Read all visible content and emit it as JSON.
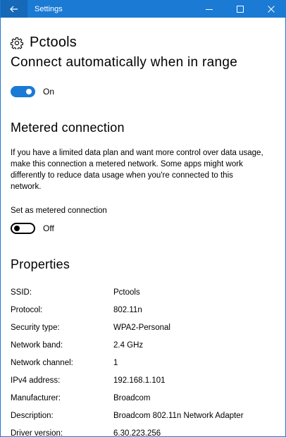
{
  "window": {
    "title": "Settings",
    "accent_color": "#1a7ad4"
  },
  "network": {
    "name": "Pctools",
    "icon": "gear-icon"
  },
  "connect_auto": {
    "heading": "Connect automatically when in range",
    "toggle_state": "on",
    "toggle_label": "On"
  },
  "metered": {
    "heading": "Metered connection",
    "description": "If you have a limited data plan and want more control over data usage, make this connection a metered network. Some apps might work differently to reduce data usage when you're connected to this network.",
    "setting_label": "Set as metered connection",
    "toggle_state": "off",
    "toggle_label": "Off"
  },
  "properties": {
    "heading": "Properties",
    "rows": [
      {
        "key": "SSID:",
        "value": "Pctools"
      },
      {
        "key": "Protocol:",
        "value": "802.11n"
      },
      {
        "key": "Security type:",
        "value": "WPA2-Personal"
      },
      {
        "key": "Network band:",
        "value": "2.4 GHz"
      },
      {
        "key": "Network channel:",
        "value": "1"
      },
      {
        "key": "IPv4 address:",
        "value": "192.168.1.101"
      },
      {
        "key": "Manufacturer:",
        "value": "Broadcom"
      },
      {
        "key": "Description:",
        "value": "Broadcom 802.11n Network Adapter"
      },
      {
        "key": "Driver version:",
        "value": "6.30.223.256"
      }
    ]
  }
}
